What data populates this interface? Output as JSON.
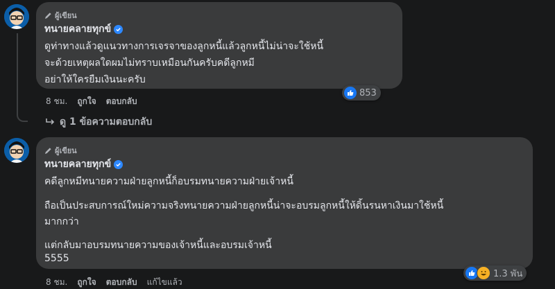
{
  "comment1": {
    "author_badge": "ผู้เขียน",
    "author_name": "ทนายคลายทุกข์",
    "lines": [
      "ดูท่าทางแล้วดูแนวทางการเจรจาของลูกหนี้แล้วลูกหนี้ไม่น่าจะใช้หนี้",
      "จะด้วยเหตุผลใดผมไม่ทราบเหมือนกันครับคดีลูกหมี",
      "อย่าให้ใครยืมเงินนะครับ"
    ],
    "reaction_count": "853",
    "time": "8 ชม.",
    "like_label": "ถูกใจ",
    "reply_label": "ตอบกลับ"
  },
  "view_replies_label": "ดู 1 ข้อความตอบกลับ",
  "comment2": {
    "author_badge": "ผู้เขียน",
    "author_name": "ทนายคลายทุกข์",
    "lines": [
      "คดีลูกหมีทนายความฝ่ายลูกหนี้ก็อบรมทนายความฝ่ายเจ้าหนี้",
      "ถือเป็นประสบการณ์ใหม่ความจริงทนายความฝ่ายลูกหนี้น่าจะอบรมลูกหนี้ให้ดิ้นรนหาเงินมาใช้หนี้",
      "มากกว่า",
      "แต่กลับมาอบรมทนายความของเจ้าหนี้และอบรมเจ้าหนี้",
      "5555"
    ],
    "reaction_count": "1.3 พัน",
    "time": "8 ชม.",
    "like_label": "ถูกใจ",
    "reply_label": "ตอบกลับ",
    "edited_label": "แก้ไขแล้ว"
  },
  "colors": {
    "background": "#18191a",
    "bubble": "#3a3b3c",
    "accent": "#1877f2"
  },
  "icons": [
    "avatar",
    "pencil-icon",
    "verified-icon",
    "like-reaction-icon",
    "haha-reaction-icon",
    "reply-arrow-icon"
  ]
}
